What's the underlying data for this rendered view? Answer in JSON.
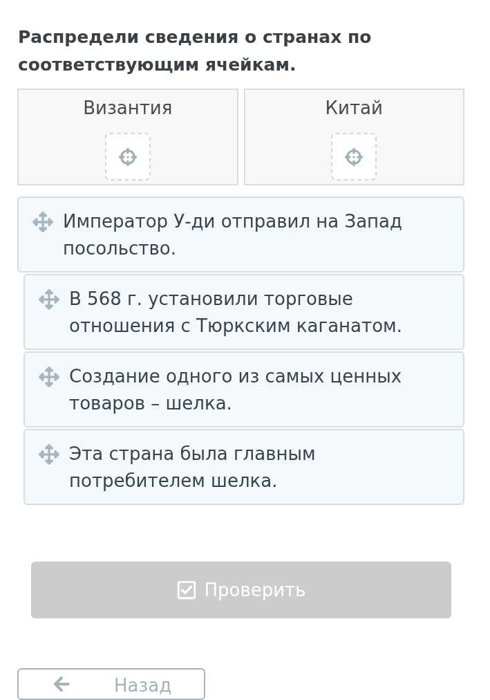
{
  "title": "Распредели сведения о странах по соответствующим ячейкам.",
  "categories": [
    {
      "label": "Византия"
    },
    {
      "label": "Китай"
    }
  ],
  "cards": [
    {
      "text": "Император У-ди отправил на Запад посольство.",
      "dragging": true
    },
    {
      "text": "В 568 г. установили торговые отношения с Тюркским каганатом.",
      "dragging": false
    },
    {
      "text": "Создание одного из самых ценных товаров – шелка.",
      "dragging": false
    },
    {
      "text": "Эта страна была главным потребителем шелка.",
      "dragging": false
    }
  ],
  "check_button": {
    "label": "Проверить",
    "disabled": true
  },
  "back_button": {
    "label": "Назад"
  }
}
